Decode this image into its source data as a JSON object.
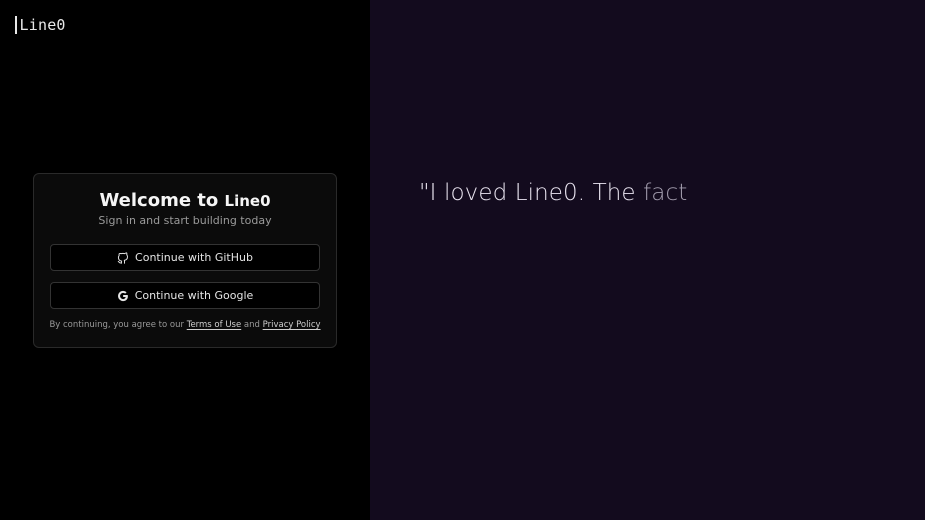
{
  "brand": {
    "logo_text": "Line0"
  },
  "auth_card": {
    "title_prefix": "Welcome to",
    "title_brand": "Line0",
    "subtitle": "Sign in and start building today",
    "github_button_label": "Continue with GitHub",
    "google_button_label": "Continue with Google",
    "legal_prefix": "By continuing, you agree to our",
    "terms_link": "Terms of Use",
    "legal_joiner": "and",
    "privacy_link": "Privacy Policy"
  },
  "testimonial": {
    "quote_main": "\"I loved Line0. The",
    "quote_fading": "fact"
  },
  "colors": {
    "left_background": "#000000",
    "right_background": "#130b1e",
    "card_background": "#0b0b0b",
    "card_border": "#2a2a2a"
  },
  "icons": {
    "github": "github-icon",
    "google": "google-icon"
  }
}
